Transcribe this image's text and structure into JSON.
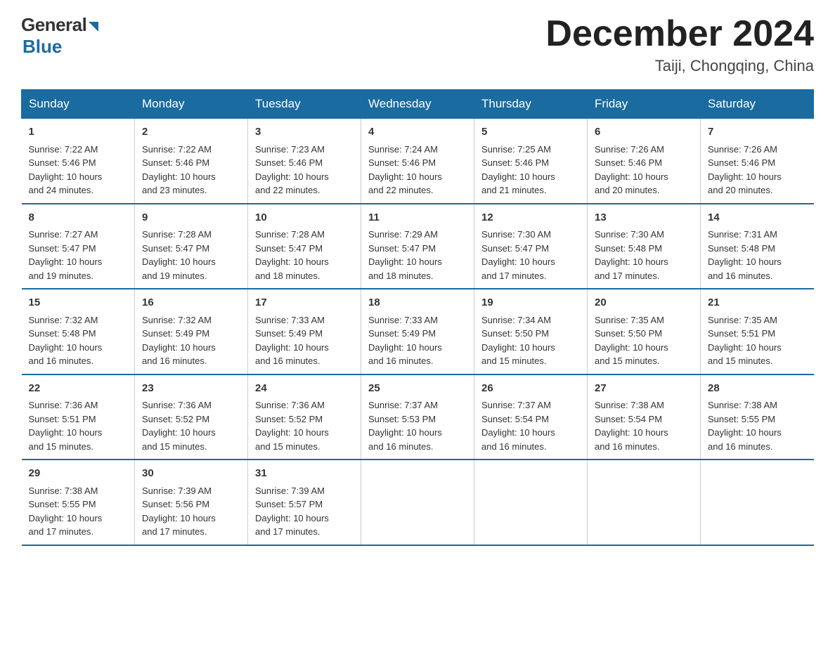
{
  "logo": {
    "general": "General",
    "blue": "Blue"
  },
  "title": "December 2024",
  "location": "Taiji, Chongqing, China",
  "days_of_week": [
    "Sunday",
    "Monday",
    "Tuesday",
    "Wednesday",
    "Thursday",
    "Friday",
    "Saturday"
  ],
  "weeks": [
    [
      {
        "day": "1",
        "sunrise": "7:22 AM",
        "sunset": "5:46 PM",
        "daylight": "10 hours and 24 minutes."
      },
      {
        "day": "2",
        "sunrise": "7:22 AM",
        "sunset": "5:46 PM",
        "daylight": "10 hours and 23 minutes."
      },
      {
        "day": "3",
        "sunrise": "7:23 AM",
        "sunset": "5:46 PM",
        "daylight": "10 hours and 22 minutes."
      },
      {
        "day": "4",
        "sunrise": "7:24 AM",
        "sunset": "5:46 PM",
        "daylight": "10 hours and 22 minutes."
      },
      {
        "day": "5",
        "sunrise": "7:25 AM",
        "sunset": "5:46 PM",
        "daylight": "10 hours and 21 minutes."
      },
      {
        "day": "6",
        "sunrise": "7:26 AM",
        "sunset": "5:46 PM",
        "daylight": "10 hours and 20 minutes."
      },
      {
        "day": "7",
        "sunrise": "7:26 AM",
        "sunset": "5:46 PM",
        "daylight": "10 hours and 20 minutes."
      }
    ],
    [
      {
        "day": "8",
        "sunrise": "7:27 AM",
        "sunset": "5:47 PM",
        "daylight": "10 hours and 19 minutes."
      },
      {
        "day": "9",
        "sunrise": "7:28 AM",
        "sunset": "5:47 PM",
        "daylight": "10 hours and 19 minutes."
      },
      {
        "day": "10",
        "sunrise": "7:28 AM",
        "sunset": "5:47 PM",
        "daylight": "10 hours and 18 minutes."
      },
      {
        "day": "11",
        "sunrise": "7:29 AM",
        "sunset": "5:47 PM",
        "daylight": "10 hours and 18 minutes."
      },
      {
        "day": "12",
        "sunrise": "7:30 AM",
        "sunset": "5:47 PM",
        "daylight": "10 hours and 17 minutes."
      },
      {
        "day": "13",
        "sunrise": "7:30 AM",
        "sunset": "5:48 PM",
        "daylight": "10 hours and 17 minutes."
      },
      {
        "day": "14",
        "sunrise": "7:31 AM",
        "sunset": "5:48 PM",
        "daylight": "10 hours and 16 minutes."
      }
    ],
    [
      {
        "day": "15",
        "sunrise": "7:32 AM",
        "sunset": "5:48 PM",
        "daylight": "10 hours and 16 minutes."
      },
      {
        "day": "16",
        "sunrise": "7:32 AM",
        "sunset": "5:49 PM",
        "daylight": "10 hours and 16 minutes."
      },
      {
        "day": "17",
        "sunrise": "7:33 AM",
        "sunset": "5:49 PM",
        "daylight": "10 hours and 16 minutes."
      },
      {
        "day": "18",
        "sunrise": "7:33 AM",
        "sunset": "5:49 PM",
        "daylight": "10 hours and 16 minutes."
      },
      {
        "day": "19",
        "sunrise": "7:34 AM",
        "sunset": "5:50 PM",
        "daylight": "10 hours and 15 minutes."
      },
      {
        "day": "20",
        "sunrise": "7:35 AM",
        "sunset": "5:50 PM",
        "daylight": "10 hours and 15 minutes."
      },
      {
        "day": "21",
        "sunrise": "7:35 AM",
        "sunset": "5:51 PM",
        "daylight": "10 hours and 15 minutes."
      }
    ],
    [
      {
        "day": "22",
        "sunrise": "7:36 AM",
        "sunset": "5:51 PM",
        "daylight": "10 hours and 15 minutes."
      },
      {
        "day": "23",
        "sunrise": "7:36 AM",
        "sunset": "5:52 PM",
        "daylight": "10 hours and 15 minutes."
      },
      {
        "day": "24",
        "sunrise": "7:36 AM",
        "sunset": "5:52 PM",
        "daylight": "10 hours and 15 minutes."
      },
      {
        "day": "25",
        "sunrise": "7:37 AM",
        "sunset": "5:53 PM",
        "daylight": "10 hours and 16 minutes."
      },
      {
        "day": "26",
        "sunrise": "7:37 AM",
        "sunset": "5:54 PM",
        "daylight": "10 hours and 16 minutes."
      },
      {
        "day": "27",
        "sunrise": "7:38 AM",
        "sunset": "5:54 PM",
        "daylight": "10 hours and 16 minutes."
      },
      {
        "day": "28",
        "sunrise": "7:38 AM",
        "sunset": "5:55 PM",
        "daylight": "10 hours and 16 minutes."
      }
    ],
    [
      {
        "day": "29",
        "sunrise": "7:38 AM",
        "sunset": "5:55 PM",
        "daylight": "10 hours and 17 minutes."
      },
      {
        "day": "30",
        "sunrise": "7:39 AM",
        "sunset": "5:56 PM",
        "daylight": "10 hours and 17 minutes."
      },
      {
        "day": "31",
        "sunrise": "7:39 AM",
        "sunset": "5:57 PM",
        "daylight": "10 hours and 17 minutes."
      },
      null,
      null,
      null,
      null
    ]
  ],
  "labels": {
    "sunrise": "Sunrise:",
    "sunset": "Sunset:",
    "daylight": "Daylight:"
  }
}
